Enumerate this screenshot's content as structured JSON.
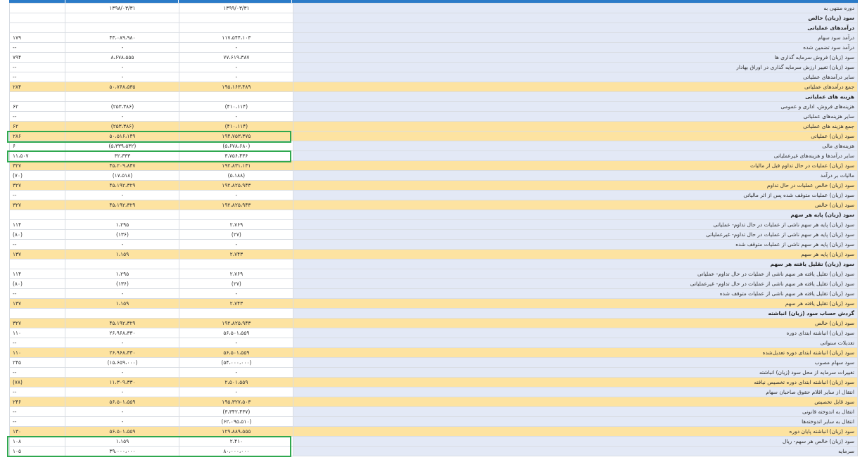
{
  "columns": {
    "current_period": "۱۳۹۹/۰۳/۳۱",
    "previous_period": "۱۳۹۸/۰۳/۳۱",
    "change_pct": ""
  },
  "rows": [
    {
      "label": "دوره منتهی به",
      "v1": "۱۳۹۹/۰۳/۳۱",
      "v2": "۱۳۹۸/۰۳/۳۱",
      "chg": "",
      "kind": "plain"
    },
    {
      "label": "سود (زیان) خالص",
      "v1": "",
      "v2": "",
      "chg": "",
      "kind": "header"
    },
    {
      "label": "درآمدهای عملیاتی",
      "v1": "",
      "v2": "",
      "chg": "",
      "kind": "header"
    },
    {
      "label": "درآمد سود سهام",
      "v1": "۱۱۷،۵۴۴،۱۰۳",
      "v2": "۴۳،۰۸۹،۹۸۰",
      "chg": "۱۷۹",
      "kind": "plain"
    },
    {
      "label": "درآمد سود تضمین شده",
      "v1": "-",
      "v2": "-",
      "chg": "--",
      "kind": "plain"
    },
    {
      "label": "سود (زیان) فروش سرمایه گذاری ها",
      "v1": "۷۷،۶۱۹،۳۸۷",
      "v2": "۸،۶۷۸،۵۵۵",
      "chg": "۷۹۴",
      "kind": "plain",
      "chgClass": "pos"
    },
    {
      "label": "سود (زیان) تغییر ارزش سرمایه گذاری در اوراق بهادار",
      "v1": "-",
      "v2": "-",
      "chg": "--",
      "kind": "plain"
    },
    {
      "label": "سایر درآمدهای عملیاتی",
      "v1": "-",
      "v2": "-",
      "chg": "--",
      "kind": "plain"
    },
    {
      "label": "جمع درآمدهای عملیاتی",
      "v1": "۱۹۵،۱۶۳،۴۸۹",
      "v2": "۵۰،۷۶۸،۵۳۵",
      "chg": "۲۸۴",
      "kind": "total"
    },
    {
      "label": "هزینه های عملیاتی",
      "v1": "",
      "v2": "",
      "chg": "",
      "kind": "header"
    },
    {
      "label": "هزینه‌های فروش، اداری و عمومی",
      "v1": "(۴۱۰،۱۱۴)",
      "v2": "(۲۵۳،۳۸۶)",
      "chg": "۶۲",
      "kind": "plain",
      "neg": true
    },
    {
      "label": "سایر هزینه‌های عملیاتی",
      "v1": "-",
      "v2": "-",
      "chg": "--",
      "kind": "plain"
    },
    {
      "label": "جمع هزینه های عملیاتی",
      "v1": "(۴۱۰،۱۱۴)",
      "v2": "(۲۵۳،۳۸۶)",
      "chg": "۶۲",
      "kind": "total",
      "neg": true
    },
    {
      "label": "سود (زیان) عملیاتی",
      "v1": "۱۹۴،۷۵۳،۳۷۵",
      "v2": "۵۰،۵۱۶،۱۴۹",
      "chg": "۲۸۶",
      "kind": "total"
    },
    {
      "label": "هزینه‌های مالی",
      "v1": "(۵،۶۷۸،۶۸۰)",
      "v2": "(۵،۳۳۹،۵۳۲)",
      "chg": "۶",
      "kind": "plain",
      "neg": true
    },
    {
      "label": "سایر درآمدها و هزینه‌های غیرعملیاتی",
      "v1": "۳،۷۵۶،۴۳۶",
      "v2": "۳۲،۳۳۳",
      "chg": "۱۱،۵۰۷",
      "kind": "plain"
    },
    {
      "label": "سود (زیان) عملیات در حال تداوم قبل از مالیات",
      "v1": "۱۹۲،۸۳۱،۱۳۱",
      "v2": "۴۵،۲۰۹،۸۴۷",
      "chg": "۳۲۷",
      "kind": "total"
    },
    {
      "label": "مالیات بر درآمد",
      "v1": "(۵،۱۸۸)",
      "v2": "(۱۷،۵۱۸)",
      "chg": "(۷۰)",
      "kind": "plain",
      "neg": true,
      "chgClass": "neg"
    },
    {
      "label": "سود (زیان) خالص عملیات در حال تداوم",
      "v1": "۱۹۲،۸۲۵،۹۴۳",
      "v2": "۴۵،۱۹۲،۳۲۹",
      "chg": "۳۲۷",
      "kind": "total"
    },
    {
      "label": "سود (زیان) عملیات متوقف شده پس از اثر مالیاتی",
      "v1": "-",
      "v2": "-",
      "chg": "--",
      "kind": "plain"
    },
    {
      "label": "سود (زیان) خالص",
      "v1": "۱۹۲،۸۲۵،۹۴۳",
      "v2": "۴۵،۱۹۲،۳۲۹",
      "chg": "۳۲۷",
      "kind": "total"
    },
    {
      "label": "سود (زیان) پایه هر سهم",
      "v1": "",
      "v2": "",
      "chg": "",
      "kind": "header"
    },
    {
      "label": "سود (زیان) پایه هر سهم ناشی از عملیات در حال تداوم- عملیاتی",
      "v1": "۲،۷۶۹",
      "v2": "۱،۲۹۵",
      "chg": "۱۱۴",
      "kind": "plain"
    },
    {
      "label": "سود (زیان) پایه هر سهم ناشی از عملیات در حال تداوم- غیرعملیاتی",
      "v1": "(۲۷)",
      "v2": "(۱۳۶)",
      "chg": "(۸۰)",
      "kind": "plain",
      "neg": true,
      "chgClass": "neg"
    },
    {
      "label": "سود (زیان) پایه هر سهم ناشی از عملیات متوقف شده",
      "v1": "-",
      "v2": "-",
      "chg": "--",
      "kind": "plain"
    },
    {
      "label": "سود (زیان) پایه هر سهم",
      "v1": "۲،۷۴۳",
      "v2": "۱،۱۵۹",
      "chg": "۱۳۷",
      "kind": "total"
    },
    {
      "label": "سود (زیان) تقلیل یافته هر سهم",
      "v1": "",
      "v2": "",
      "chg": "",
      "kind": "header"
    },
    {
      "label": "سود (زیان) تقلیل یافته هر سهم ناشی از عملیات در حال تداوم- عملیاتی",
      "v1": "۲،۷۶۹",
      "v2": "۱،۲۹۵",
      "chg": "۱۱۴",
      "kind": "plain"
    },
    {
      "label": "سود (زیان) تقلیل یافته هر سهم ناشی از عملیات در حال تداوم- غیرعملیاتی",
      "v1": "(۲۷)",
      "v2": "(۱۳۶)",
      "chg": "(۸۰)",
      "kind": "plain",
      "neg": true,
      "chgClass": "neg"
    },
    {
      "label": "سود (زیان) تقلیل یافته هر سهم ناشی از عملیات متوقف شده",
      "v1": "-",
      "v2": "-",
      "chg": "--",
      "kind": "plain"
    },
    {
      "label": "سود (زیان) تقلیل یافته هر سهم",
      "v1": "۲،۷۴۳",
      "v2": "۱،۱۵۹",
      "chg": "۱۳۷",
      "kind": "total"
    },
    {
      "label": "گردش حساب سود (زیان) انباشته",
      "v1": "",
      "v2": "",
      "chg": "",
      "kind": "header"
    },
    {
      "label": "سود (زیان) خالص",
      "v1": "۱۹۲،۸۲۵،۹۴۳",
      "v2": "۴۵،۱۹۲،۳۲۹",
      "chg": "۳۲۷",
      "kind": "total"
    },
    {
      "label": "سود (زیان) انباشته ابتدای دوره",
      "v1": "۵۶،۵۰۱،۵۵۹",
      "v2": "۲۶،۹۶۸،۳۳۰",
      "chg": "۱۱۰",
      "kind": "plain"
    },
    {
      "label": "تعدیلات سنواتی",
      "v1": "-",
      "v2": "-",
      "chg": "--",
      "kind": "plain"
    },
    {
      "label": "سود (زیان) انباشته ابتدای دوره تعدیل‌شده",
      "v1": "۵۶،۵۰۱،۵۵۹",
      "v2": "۲۶،۹۶۸،۳۳۰",
      "chg": "۱۱۰",
      "kind": "total"
    },
    {
      "label": "سود سهام مصوب",
      "v1": "(۵۴،۰۰۰،۰۰۰)",
      "v2": "(۱۵،۶۵۹،۰۰۰)",
      "chg": "۲۴۵",
      "kind": "plain",
      "neg": true
    },
    {
      "label": "تغییرات سرمایه از محل سود (زیان) انباشته",
      "v1": "-",
      "v2": "-",
      "chg": "--",
      "kind": "plain"
    },
    {
      "label": "سود (زیان) انباشته ابتدای دوره تخصیص نیافته",
      "v1": "۲،۵۰۱،۵۵۹",
      "v2": "۱۱،۳۰۹،۳۳۰",
      "chg": "(۷۸)",
      "kind": "total",
      "chgClass": "neg"
    },
    {
      "label": "انتقال از سایر اقلام حقوق صاحبان سهام",
      "v1": "-",
      "v2": "-",
      "chg": "--",
      "kind": "plain"
    },
    {
      "label": "سود قابل تخصیص",
      "v1": "۱۹۵،۳۲۷،۵۰۳",
      "v2": "۵۶،۵۰۱،۵۵۹",
      "chg": "۲۴۶",
      "kind": "total"
    },
    {
      "label": "انتقال به اندوخته قانونی",
      "v1": "(۳،۳۴۲،۴۳۷)",
      "v2": "-",
      "chg": "--",
      "kind": "plain",
      "negV1": true
    },
    {
      "label": "انتقال به سایر اندوخته‌ها",
      "v1": "(۶۲،۰۹۵،۵۱۰)",
      "v2": "-",
      "chg": "--",
      "kind": "plain",
      "negV1": true
    },
    {
      "label": "سود (زیان) انباشته پایان دوره",
      "v1": "۱۲۹،۸۸۹،۵۵۵",
      "v2": "۵۶،۵۰۱،۵۵۹",
      "chg": "۱۳۰",
      "kind": "total"
    },
    {
      "label": "سود (زیان) خالص هر سهم- ریال",
      "v1": "۲،۴۱۰",
      "v2": "۱،۱۵۹",
      "chg": "۱۰۸",
      "kind": "plain"
    },
    {
      "label": "سرمایه",
      "v1": "۸۰،۰۰۰،۰۰۰",
      "v2": "۳۹،۰۰۰،۰۰۰",
      "chg": "۱۰۵",
      "kind": "plain"
    }
  ],
  "colors": {
    "header_bar": "#2b7bc8",
    "label_bg": "#e3e9f6",
    "total_bg": "#fde3a1",
    "negative": "#d32f2f",
    "highlight": "#2fa84f"
  }
}
